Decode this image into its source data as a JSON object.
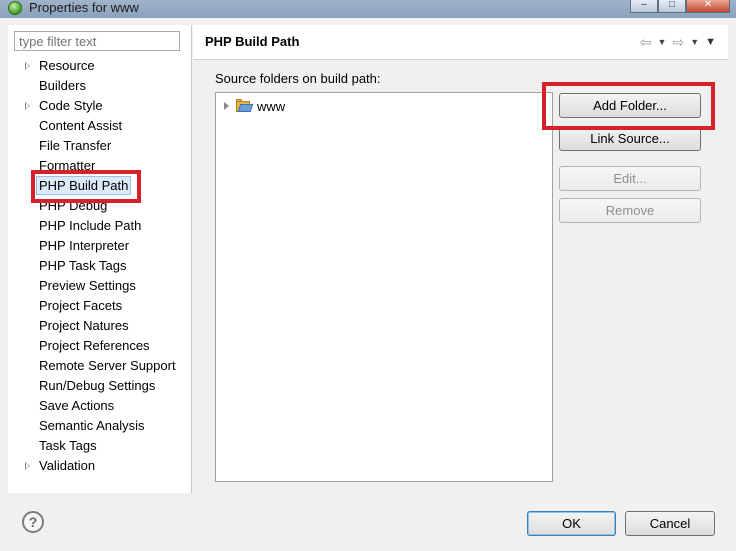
{
  "window": {
    "title": "Properties for www",
    "controls": {
      "minimize": "‒",
      "maximize": "□",
      "close": "✕"
    }
  },
  "filter": {
    "placeholder": "type filter text",
    "value": ""
  },
  "sidebar": {
    "items": [
      {
        "label": "Resource",
        "expandable": true
      },
      {
        "label": "Builders",
        "expandable": false
      },
      {
        "label": "Code Style",
        "expandable": true
      },
      {
        "label": "Content Assist",
        "expandable": false
      },
      {
        "label": "File Transfer",
        "expandable": false
      },
      {
        "label": "Formatter",
        "expandable": false
      },
      {
        "label": "PHP Build Path",
        "expandable": false,
        "selected": true
      },
      {
        "label": "PHP Debug",
        "expandable": false
      },
      {
        "label": "PHP Include Path",
        "expandable": false
      },
      {
        "label": "PHP Interpreter",
        "expandable": false
      },
      {
        "label": "PHP Task Tags",
        "expandable": false
      },
      {
        "label": "Preview Settings",
        "expandable": false
      },
      {
        "label": "Project Facets",
        "expandable": false
      },
      {
        "label": "Project Natures",
        "expandable": false
      },
      {
        "label": "Project References",
        "expandable": false
      },
      {
        "label": "Remote Server Support",
        "expandable": false
      },
      {
        "label": "Run/Debug Settings",
        "expandable": false
      },
      {
        "label": "Save Actions",
        "expandable": false
      },
      {
        "label": "Semantic Analysis",
        "expandable": false
      },
      {
        "label": "Task Tags",
        "expandable": false
      },
      {
        "label": "Validation",
        "expandable": true
      }
    ]
  },
  "page": {
    "title": "PHP Build Path",
    "section_label": "Source folders on build path:",
    "source_folders": [
      {
        "name": "www"
      }
    ],
    "buttons": {
      "add_folder": "Add Folder...",
      "link_source": "Link Source...",
      "edit": "Edit...",
      "remove": "Remove"
    }
  },
  "footer": {
    "help": "?",
    "ok": "OK",
    "cancel": "Cancel"
  },
  "colors": {
    "highlight_box": "#d7222b",
    "selection": "#dbe9f8"
  }
}
